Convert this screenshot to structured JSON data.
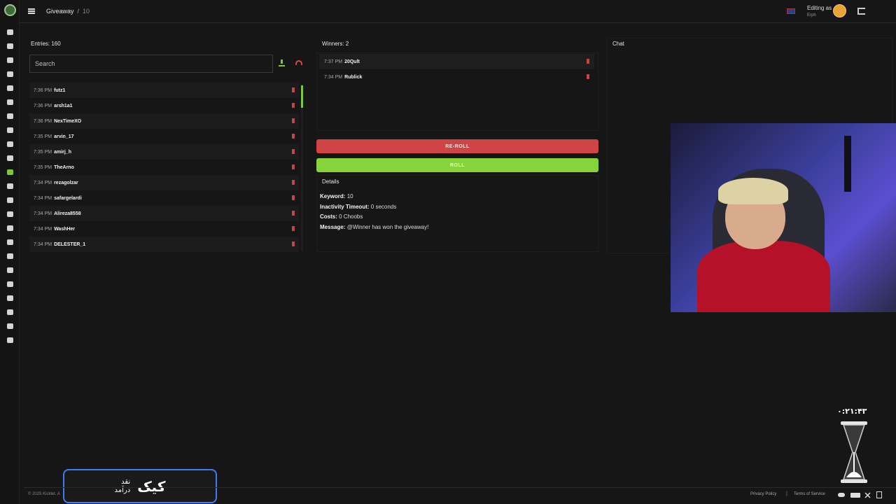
{
  "header": {
    "breadcrumb": {
      "section": "Giveaway",
      "separator": "/",
      "id": "10"
    },
    "editing_label": "Editing as",
    "editing_user": "Erph"
  },
  "entries": {
    "label": "Entries: 160",
    "search_placeholder": "Search",
    "items": [
      {
        "time": "7:36 PM",
        "name": "futz1"
      },
      {
        "time": "7:36 PM",
        "name": "arsh1a1"
      },
      {
        "time": "7:36 PM",
        "name": "NexTimeXO"
      },
      {
        "time": "7:35 PM",
        "name": "arvin_17"
      },
      {
        "time": "7:35 PM",
        "name": "amirj_h"
      },
      {
        "time": "7:35 PM",
        "name": "TheArno"
      },
      {
        "time": "7:34 PM",
        "name": "rezagolzar"
      },
      {
        "time": "7:34 PM",
        "name": "safargelardi"
      },
      {
        "time": "7:34 PM",
        "name": "Alireza8558"
      },
      {
        "time": "7:34 PM",
        "name": "WashHer"
      },
      {
        "time": "7:34 PM",
        "name": "DELESTER_1"
      }
    ]
  },
  "winners": {
    "label": "Winners: 2",
    "items": [
      {
        "time": "7:37 PM",
        "name": "20Qult"
      },
      {
        "time": "7:34 PM",
        "name": "Rublick"
      }
    ]
  },
  "buttons": {
    "reroll": "RE-ROLL",
    "roll": "ROLL"
  },
  "details": {
    "title": "Details",
    "keyword_label": "Keyword:",
    "keyword_value": "10",
    "inactivity_label": "Inactivity Timeout:",
    "inactivity_value": "0 seconds",
    "costs_label": "Costs:",
    "costs_value": "0 Choobs",
    "message_label": "Message:",
    "message_value": "@Winner has won the giveaway!"
  },
  "chat": {
    "label": "Chat"
  },
  "overlay": {
    "timer": "۰:۲۱:۴۳",
    "kick_big": "کیک",
    "kick_small_1": "نقد",
    "kick_small_2": "درآمد"
  },
  "footer": {
    "copyright": "© 2025 Kicklet. A",
    "privacy": "Privacy Policy",
    "separator": "|",
    "terms": "Terms of Service"
  },
  "colors": {
    "accent_green": "#86d33a",
    "danger_red": "#cf4545",
    "background": "#161616"
  },
  "icons": {
    "sidebar": [
      "dashboard-icon",
      "document-icon",
      "commands-icon",
      "hammer-icon",
      "chat-icon",
      "timer-icon",
      "shield-icon",
      "alert-icon",
      "music-icon",
      "star-icon",
      "gift-icon",
      "cart-icon",
      "link-icon",
      "stats-icon",
      "video-icon",
      "box-icon",
      "emoji-icon",
      "clapper-icon",
      "message-icon",
      "monitor-icon",
      "search-icon",
      "gamepad-icon",
      "card-icon"
    ],
    "active_sidebar": "gift-icon"
  }
}
